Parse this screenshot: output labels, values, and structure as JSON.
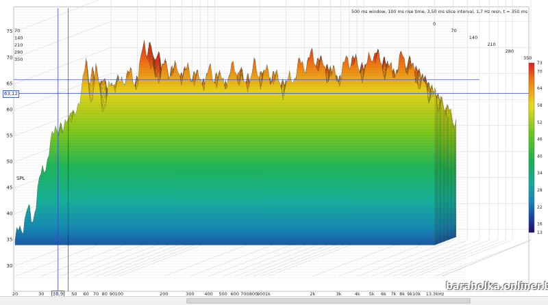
{
  "chart_data": {
    "type": "waterfall",
    "ylabel": "SPL",
    "y_ticks": [
      "75",
      "70",
      "65",
      "60",
      "55",
      "50",
      "45",
      "40",
      "35",
      "30"
    ],
    "ylim": [
      28,
      77
    ],
    "x_ticks": [
      "20",
      "30",
      "40",
      "50",
      "60",
      "70",
      "80",
      "90",
      "100",
      "200",
      "300",
      "400",
      "500",
      "600",
      "700",
      "800",
      "900",
      "1k",
      "2k",
      "3k",
      "4k",
      "5k",
      "6k",
      "7k",
      "8k",
      "9k",
      "10k",
      "13.3kHz"
    ],
    "x_scale": "log",
    "xlim_hz": [
      20,
      13300
    ],
    "time_ticks": [
      "0",
      "70",
      "140",
      "210",
      "280",
      "350"
    ],
    "time_ticks_left": [
      "70",
      "140",
      "210",
      "280",
      "350"
    ],
    "time_unit": "ms",
    "info": "500 ms window, 100 ms rise time, 3,50 ms slice interval, 1,7 Hz resn, t = 350 ms",
    "cursor": {
      "x_label": "38,9",
      "y_label": "63,12",
      "x_hz": 38.9,
      "y_spl": 63.12
    },
    "colorbar": {
      "ticks": [
        "73",
        "70",
        "64",
        "58",
        "52",
        "46",
        "40",
        "34",
        "28",
        "22",
        "16",
        "13"
      ],
      "range": [
        13,
        73
      ]
    },
    "envelope_front": [
      [
        20,
        35
      ],
      [
        22,
        37
      ],
      [
        24,
        41
      ],
      [
        26,
        38
      ],
      [
        28,
        44
      ],
      [
        30,
        47
      ],
      [
        32,
        50
      ],
      [
        35,
        53
      ],
      [
        38,
        58
      ],
      [
        42,
        54
      ],
      [
        45,
        60
      ],
      [
        50,
        57
      ],
      [
        55,
        64
      ],
      [
        60,
        68
      ],
      [
        65,
        62
      ],
      [
        70,
        67
      ],
      [
        80,
        60
      ],
      [
        90,
        66
      ],
      [
        100,
        64
      ],
      [
        110,
        67
      ],
      [
        130,
        65
      ],
      [
        150,
        73
      ],
      [
        170,
        66
      ],
      [
        200,
        68
      ],
      [
        250,
        67
      ],
      [
        300,
        67
      ],
      [
        350,
        65
      ],
      [
        400,
        67
      ],
      [
        500,
        65
      ],
      [
        600,
        68
      ],
      [
        700,
        64
      ],
      [
        800,
        68
      ],
      [
        900,
        66
      ],
      [
        1000,
        67
      ],
      [
        1300,
        64
      ],
      [
        1600,
        68
      ],
      [
        2000,
        70
      ],
      [
        2500,
        67
      ],
      [
        3000,
        66
      ],
      [
        3500,
        70
      ],
      [
        4000,
        68
      ],
      [
        4500,
        67
      ],
      [
        5000,
        71
      ],
      [
        6000,
        68
      ],
      [
        7000,
        67
      ],
      [
        8000,
        70
      ],
      [
        10000,
        66
      ],
      [
        13300,
        62
      ]
    ],
    "floor_spl": 34
  },
  "watermark": "baraholka.onliner.by"
}
